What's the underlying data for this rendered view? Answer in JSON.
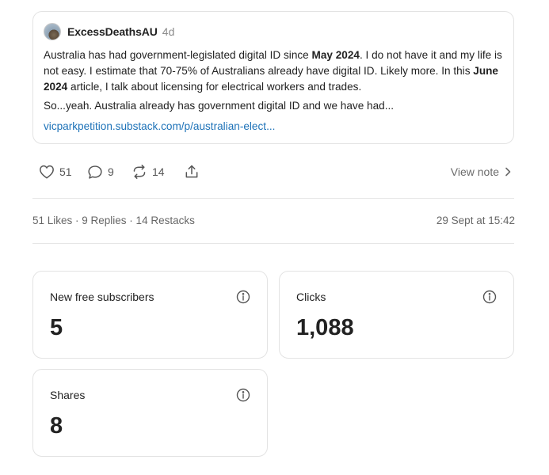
{
  "post": {
    "author": "ExcessDeathsAU",
    "age": "4d",
    "paragraph1": {
      "t1": "Australia has had government-legislated digital ID since ",
      "b1": "May 2024",
      "t2": ". I do not have it and my life is not easy. I estimate that 70-75% of Australians already have digital ID. Likely more. In this ",
      "b2": "June 2024",
      "t3": " article, I talk about licensing for electrical workers and trades."
    },
    "paragraph2": "So...yeah. Australia already has government digital ID and we have had...",
    "link": "vicparkpetition.substack.com/p/australian-elect..."
  },
  "actions": {
    "likes": "51",
    "replies": "9",
    "restacks": "14",
    "view_note": "View note"
  },
  "summary": {
    "text": "51 Likes · 9 Replies · 14 Restacks",
    "date": "29 Sept at 15:42"
  },
  "stats": [
    {
      "label": "New free subscribers",
      "value": "5"
    },
    {
      "label": "Clicks",
      "value": "1,088"
    },
    {
      "label": "Shares",
      "value": "8"
    }
  ],
  "colors": {
    "link": "#1d72b8",
    "border": "#e3e3e3",
    "muted": "#666666"
  }
}
